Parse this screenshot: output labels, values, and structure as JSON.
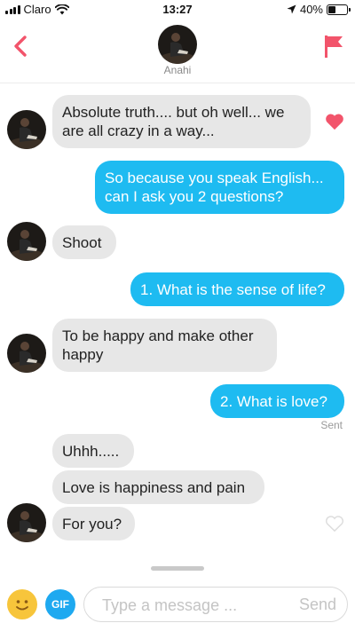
{
  "status_bar": {
    "carrier": "Claro",
    "time": "13:27",
    "battery_percent": "40%",
    "battery_level": 0.4,
    "icons": [
      "signal-icon",
      "wifi-icon",
      "location-arrow-icon",
      "battery-icon"
    ]
  },
  "header": {
    "contact_name": "Anahi",
    "back_icon": "chevron-left-icon",
    "report_icon": "flag-icon",
    "accent_color": "#f2546b"
  },
  "messages": [
    {
      "from": "them",
      "text": "Absolute truth.... but oh well... we are all crazy in a way...",
      "liked": true
    },
    {
      "from": "me",
      "text": "So because you speak English... can I ask you 2 questions?"
    },
    {
      "from": "them",
      "text": "Shoot"
    },
    {
      "from": "me",
      "text": "1. What is the sense of life?"
    },
    {
      "from": "them",
      "text": "To be happy and make other happy"
    },
    {
      "from": "me",
      "text": "2. What is love?",
      "status": "Sent"
    },
    {
      "from": "them",
      "text": "Uhhh....."
    },
    {
      "from": "them",
      "text": "Love is happiness and pain"
    },
    {
      "from": "them",
      "text": "For you?",
      "liked": false
    }
  ],
  "input_bar": {
    "gif_label": "GIF",
    "placeholder": "Type a message ...",
    "value": "",
    "send_label": "Send",
    "emoji_icon": "smiley-icon"
  },
  "colors": {
    "sent_bubble": "#1ebbf1",
    "received_bubble": "#e7e7e7",
    "like_heart": "#f2546b",
    "emoji": "#f7c53b",
    "gif": "#1ea9f0"
  }
}
